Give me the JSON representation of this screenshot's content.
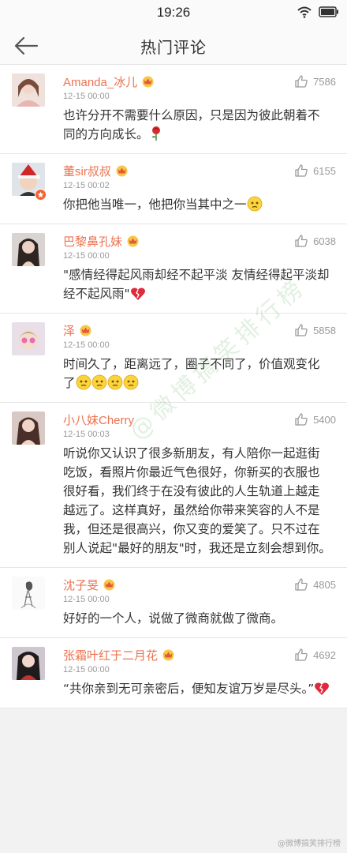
{
  "status_bar": {
    "time": "19:26"
  },
  "nav": {
    "title": "热门评论"
  },
  "comments": [
    {
      "username": "Amanda_冰儿",
      "time": "12-15 00:00",
      "likes": "7586",
      "text": "也许分开不需要什么原因，只是因为彼此朝着不同的方向成长。"
    },
    {
      "username": "董sir叔叔",
      "time": "12-15 00:02",
      "likes": "6155",
      "text": "你把他当唯一，他把你当其中之一"
    },
    {
      "username": "巴黎鼻孔妹",
      "time": "12-15 00:00",
      "likes": "6038",
      "text": "\"感情经得起风雨却经不起平淡 友情经得起平淡却经不起风雨\""
    },
    {
      "username": "泽",
      "time": "12-15 00:00",
      "likes": "5858",
      "text": "时间久了，距离远了，圈子不同了，价值观变化了"
    },
    {
      "username": "小八妹Cherry",
      "time": "12-15 00:03",
      "likes": "5400",
      "text": "听说你又认识了很多新朋友，有人陪你一起逛街吃饭，看照片你最近气色很好，你新买的衣服也很好看，我们终于在没有彼此的人生轨道上越走越远了。这样真好，虽然给你带来笑容的人不是我，但还是很高兴，你又变的爱笑了。只不过在别人说起\"最好的朋友\"时，我还是立刻会想到你。"
    },
    {
      "username": "沈子旻",
      "time": "12-15 00:00",
      "likes": "4805",
      "text": "好好的一个人，说做了微商就做了微商。"
    },
    {
      "username": "张霜叶红于二月花",
      "time": "12-15 00:00",
      "likes": "4692",
      "text": "“共你亲到无可亲密后，便知友谊万岁是尽头。”"
    }
  ],
  "watermark": {
    "text": "@微博搞笑排行榜"
  },
  "corner_mark": {
    "text": "@微博搞笑排行榜"
  },
  "colors": {
    "username": "#eb7350",
    "badge": "#f7612c"
  }
}
